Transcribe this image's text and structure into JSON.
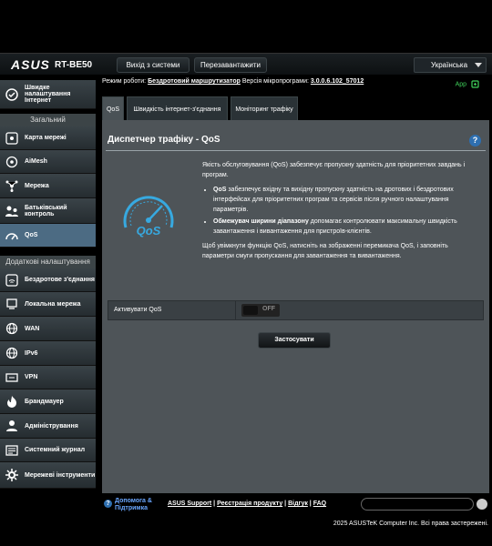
{
  "header": {
    "logo": "ASUS",
    "model": "RT-BE50",
    "logout_label": "Вихід з системи",
    "reboot_label": "Перезавантажити",
    "language": "Українська"
  },
  "status": {
    "mode_label": "Режим роботи:",
    "mode_value": "Бездротовий маршрутизатор",
    "firmware_label": "Версія мікропрограми:",
    "firmware_value": "3.0.0.6.102_57012",
    "app_label": "App"
  },
  "sidebar": {
    "quick_setup": "Швидке налаштування Інтернет",
    "general_header": "Загальний",
    "general_items": [
      {
        "label": "Карта мережі",
        "icon": "network-map-icon"
      },
      {
        "label": "AiMesh",
        "icon": "aimesh-icon"
      },
      {
        "label": "Мережа",
        "icon": "network-icon"
      },
      {
        "label": "Батьківський контроль",
        "icon": "parental-control-icon"
      },
      {
        "label": "QoS",
        "icon": "qos-icon"
      }
    ],
    "advanced_header": "Додаткові налаштування",
    "advanced_items": [
      {
        "label": "Бездротове з'єднання",
        "icon": "wireless-icon"
      },
      {
        "label": "Локальна мережа",
        "icon": "lan-icon"
      },
      {
        "label": "WAN",
        "icon": "wan-icon"
      },
      {
        "label": "IPv6",
        "icon": "ipv6-icon"
      },
      {
        "label": "VPN",
        "icon": "vpn-icon"
      },
      {
        "label": "Брандмауер",
        "icon": "firewall-icon"
      },
      {
        "label": "Адміністрування",
        "icon": "admin-icon"
      },
      {
        "label": "Системний журнал",
        "icon": "syslog-icon"
      },
      {
        "label": "Мережеві інструменти",
        "icon": "network-tools-icon"
      }
    ]
  },
  "tabs": [
    "QoS",
    "Швидкість інтернет-з'єднання",
    "Моніторинг трафіку"
  ],
  "panel": {
    "title": "Диспетчер трафіку - QoS",
    "gauge_text": "QoS",
    "intro": "Якість обслуговування (QoS) забезпечує пропускну здатність для пріоритетних завдань і програм.",
    "bullet1_bold": "QoS",
    "bullet1_text": " забезпечує вхідну та вихідну пропускну здатність на дротових і бездротових інтерфейсах для пріоритетних програм та сервісів після ручного налаштування параметрів.",
    "bullet2_bold": "Обмежувач ширини діапазону",
    "bullet2_text": " допомагає контролювати максимальну швидкість завантаження і вивантаження для пристроїв-клієнтів.",
    "outro": "Щоб увімкнути функцію QoS, натисніть на зображенні перемикача QoS, і заповніть параметри смуги пропускання для завантаження та вивантаження.",
    "enable_label": "Активувати QoS",
    "toggle_state": "OFF",
    "apply_label": "Застосувати"
  },
  "footer": {
    "help_label": "Допомога & Підтримка",
    "link_support": "ASUS Support",
    "link_register": "Реєстрація продукту",
    "link_feedback": "Відгук",
    "link_faq": "FAQ",
    "copyright": "2025 ASUSTeK Computer Inc. Всі права застережені."
  },
  "colors": {
    "accent": "#4c6b83",
    "panel": "#4e5458",
    "gauge": "#37a9e0",
    "app_green": "#3fcf5a"
  }
}
